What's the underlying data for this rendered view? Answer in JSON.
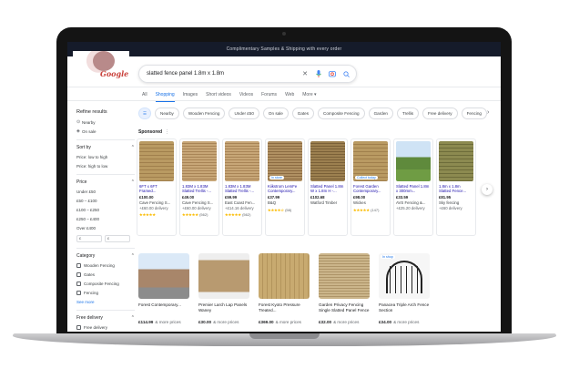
{
  "banner": "Complimentary Samples & Shipping with every order",
  "search": {
    "query": "slatted fence panel 1.8m x 1.8m",
    "logo_text": "Google"
  },
  "tabs": [
    "All",
    "Shopping",
    "Images",
    "Short videos",
    "Videos",
    "Forums",
    "Web",
    "More ▾"
  ],
  "chips": [
    "Nearby",
    "Wooden Fencing",
    "Under £50",
    "On sale",
    "Gates",
    "Composite Fencing",
    "Garden",
    "Trellis",
    "Free delivery",
    "Fencing"
  ],
  "sidebar": {
    "title": "Refine results",
    "quick": [
      "Nearby",
      "On sale"
    ],
    "sort_by": "Sort by",
    "sort_options": [
      "Price: low to high",
      "Price: high to low"
    ],
    "price": "Price",
    "price_options": [
      "Under £50",
      "£50 – £100",
      "£100 – £250",
      "£250 – £400",
      "Over £400"
    ],
    "price_min": "£",
    "price_max": "£",
    "category": "Category",
    "categories": [
      "Wooden Fencing",
      "Gates",
      "Composite Fencing",
      "Fencing"
    ],
    "see_more": "See more",
    "free_delivery": "Free delivery",
    "free_delivery_option": "Free delivery"
  },
  "sponsored": {
    "label": "Sponsored",
    "products": [
      {
        "title": "6FT x 6FT Framed...",
        "price": "£100.00",
        "store": "Cave Fencing S...",
        "delivery": "+£60.00 delivery",
        "rating": "★★★★★",
        "reviews": "",
        "tex": "wood-h",
        "badge": ""
      },
      {
        "title": "1.83M x 1.83M Slatted Trellis -...",
        "price": "£49.00",
        "store": "Cave Fencing S...",
        "delivery": "+£60.00 delivery",
        "rating": "★★★★★",
        "reviews": "(562)",
        "tex": "wood-h2",
        "badge": ""
      },
      {
        "title": "1.83M x 1.83M Slatted Trellis -...",
        "price": "£59.99",
        "store": "East Coast Fen...",
        "delivery": "+£14.16 delivery",
        "rating": "★★★★★",
        "reviews": "(562)",
        "tex": "wood-h2",
        "badge": ""
      },
      {
        "title": "Kiikstrom LemFe Contemporary...",
        "price": "£37.99",
        "store": "B&Q",
        "delivery": "",
        "rating": "★★★★☆",
        "reviews": "(58)",
        "tex": "wood-dia",
        "badge": "In store"
      },
      {
        "title": "Slatted Panel 1.8m W x 1.8m H -...",
        "price": "£102.68",
        "store": "Watford Timber",
        "delivery": "",
        "rating": "",
        "reviews": "",
        "tex": "wood-dark",
        "badge": ""
      },
      {
        "title": "Forest Garden Contemporary...",
        "price": "£98.00",
        "store": "Wickes",
        "delivery": "",
        "rating": "★★★★★",
        "reviews": "(147)",
        "tex": "wood-h",
        "badge": "Collect today"
      },
      {
        "title": "Slatted Panel 1.8m x 300mm...",
        "price": "£33.59",
        "store": "AVS Fencing &...",
        "delivery": "+£25.20 delivery",
        "rating": "",
        "reviews": "",
        "tex": "garden",
        "badge": ""
      },
      {
        "title": "1.8m x 1.8m Slatted Fence...",
        "price": "£81.95",
        "store": "Sky fencing",
        "delivery": "+£60 delivery",
        "rating": "",
        "reviews": "",
        "tex": "wood-green",
        "badge": ""
      }
    ]
  },
  "listings": [
    {
      "title": "Forest Contemporary...",
      "price": "£114.99",
      "more": "& more prices",
      "scene": "scene1",
      "inshop": ""
    },
    {
      "title": "Premier Larch Lap Panels Waney",
      "price": "£30.00",
      "more": "& more prices",
      "scene": "scene2",
      "inshop": ""
    },
    {
      "title": "Forest Kyoto Pressure Treated...",
      "price": "£369.00",
      "more": "& more prices",
      "scene": "scene3",
      "inshop": ""
    },
    {
      "title": "Garden Privacy Fencing Single Slatted Panel Fence",
      "price": "£32.00",
      "more": "& more prices",
      "scene": "scene4",
      "inshop": ""
    },
    {
      "title": "Panacea Triple Arch Fence Section",
      "price": "£34.00",
      "more": "& more prices",
      "scene": "scene5",
      "inshop": "In shop"
    }
  ],
  "colors": {
    "accent": "#1a73e8",
    "link": "#1a0dab",
    "star": "#fbbc04"
  }
}
